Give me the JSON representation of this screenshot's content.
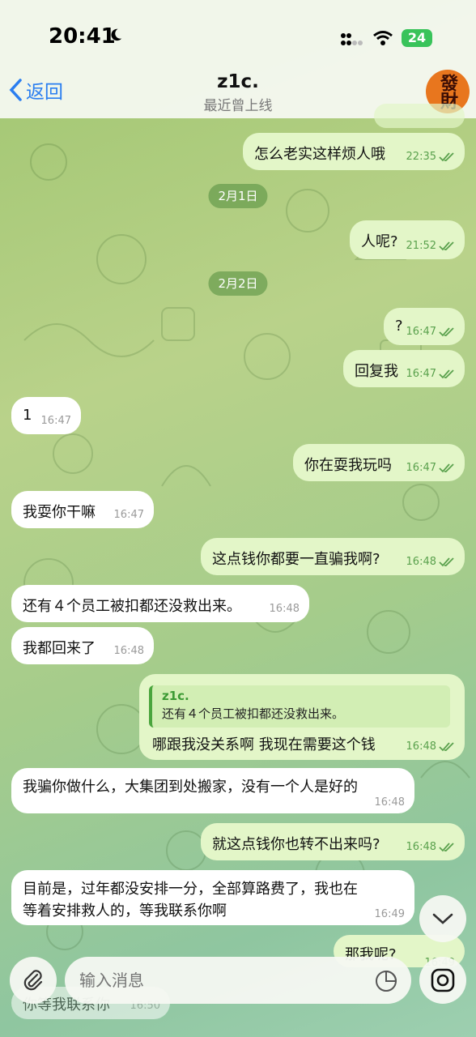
{
  "status": {
    "time": "20:41",
    "battery": "24"
  },
  "header": {
    "back_label": "返回",
    "title": "z1c.",
    "subtitle": "最近曾上线",
    "avatar_text": "發財"
  },
  "messages": [
    {
      "side": "out",
      "text": "",
      "time": "22:35"
    },
    {
      "side": "out",
      "text": "怎么老实这样烦人哦",
      "time": "22:35"
    },
    {
      "date": "2月1日"
    },
    {
      "side": "out",
      "text": "人呢?",
      "time": "21:52"
    },
    {
      "date": "2月2日"
    },
    {
      "side": "out",
      "text": "?",
      "time": "16:47"
    },
    {
      "side": "out",
      "text": "回复我",
      "time": "16:47"
    },
    {
      "side": "in",
      "text": "1",
      "time": "16:47"
    },
    {
      "side": "out",
      "text": "你在耍我玩吗",
      "time": "16:47"
    },
    {
      "side": "in",
      "text": "我耍你干嘛",
      "time": "16:47"
    },
    {
      "side": "out",
      "text": "这点钱你都要一直骗我啊?",
      "time": "16:48"
    },
    {
      "side": "in",
      "text": "还有４个员工被扣都还没救出来。",
      "time": "16:48"
    },
    {
      "side": "in",
      "text": "我都回来了",
      "time": "16:48"
    },
    {
      "side": "out",
      "reply_name": "z1c.",
      "reply_text": "还有４个员工被扣都还没救出来。",
      "text": "哪跟我没关系啊 我现在需要这个钱",
      "time": "16:48"
    },
    {
      "side": "in",
      "text": "我骗你做什么，大集团到处搬家，没有一个人是好的",
      "time": "16:48"
    },
    {
      "side": "out",
      "text": "就这点钱你也转不出来吗?",
      "time": "16:48"
    },
    {
      "side": "in",
      "text_line1": "目前是，过年都没安排一分，全部算路费了，我也在",
      "text_line2": "等着安排救人的，等我联系你啊",
      "time": "16:49"
    },
    {
      "side": "out",
      "text": "那我呢?",
      "time": "16:49"
    },
    {
      "side": "in",
      "text": "你等我联系你",
      "time": "16:50"
    }
  ],
  "composer": {
    "placeholder": "输入消息"
  }
}
